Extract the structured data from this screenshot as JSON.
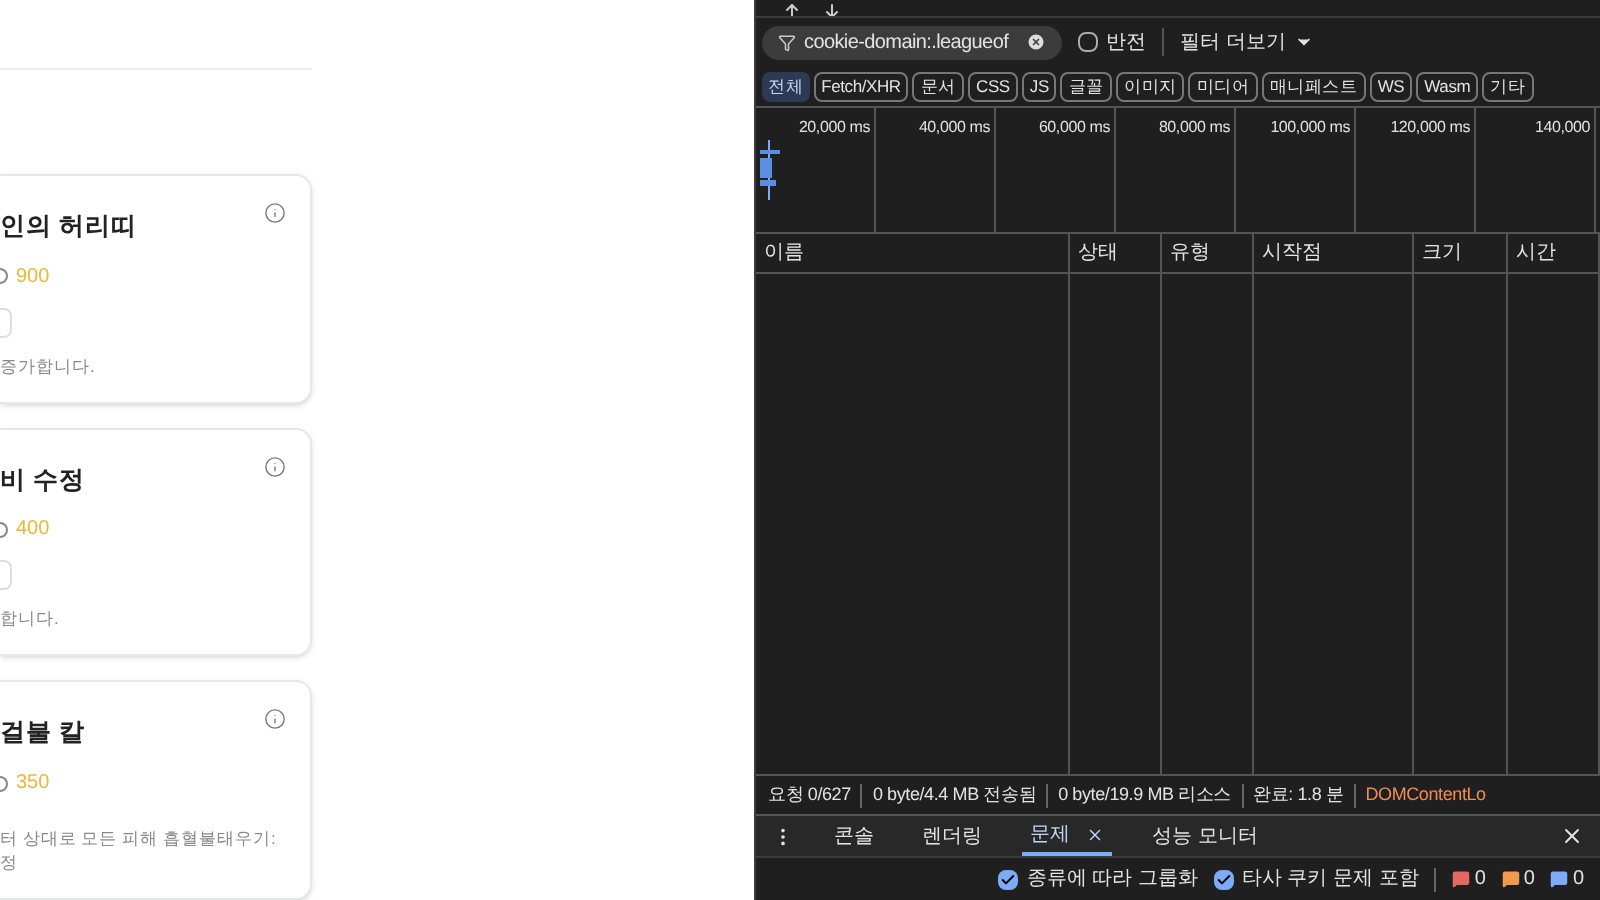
{
  "cards": [
    {
      "title": "인의 허리띠",
      "price": "900",
      "description": "증가합니다.",
      "has_box": true
    },
    {
      "title": "비 수정",
      "price": "400",
      "description": "합니다.",
      "has_box": true
    },
    {
      "title": "걸불 칼",
      "price": "350",
      "description": "터 상대로 모든 피해 흡혈불태우기: 정",
      "has_box": false
    }
  ],
  "devtools": {
    "filter": {
      "value": "cookie-domain:.leagueof",
      "invert": {
        "label": "반전",
        "checked": false
      },
      "more": "필터 더보기"
    },
    "types": [
      {
        "label": "전체",
        "selected": true
      },
      {
        "label": "Fetch/XHR",
        "selected": false
      },
      {
        "label": "문서",
        "selected": false
      },
      {
        "label": "CSS",
        "selected": false
      },
      {
        "label": "JS",
        "selected": false
      },
      {
        "label": "글꼴",
        "selected": false
      },
      {
        "label": "이미지",
        "selected": false
      },
      {
        "label": "미디어",
        "selected": false
      },
      {
        "label": "매니페스트",
        "selected": false
      },
      {
        "label": "WS",
        "selected": false
      },
      {
        "label": "Wasm",
        "selected": false
      },
      {
        "label": "기타",
        "selected": false
      }
    ],
    "timeline": {
      "ticks": [
        "20,000 ms",
        "40,000 ms",
        "60,000 ms",
        "80,000 ms",
        "100,000 ms",
        "120,000 ms",
        "140,000"
      ]
    },
    "table": {
      "columns": [
        "이름",
        "상태",
        "유형",
        "시작점",
        "크기",
        "시간"
      ]
    },
    "status_bar": [
      {
        "text": "요청 0/627",
        "kind": "plain"
      },
      {
        "text": "0 byte/4.4 MB 전송됨",
        "kind": "plain"
      },
      {
        "text": "0 byte/19.9 MB 리소스",
        "kind": "plain"
      },
      {
        "text": "완료: 1.8 분",
        "kind": "plain"
      },
      {
        "text": "DOMContentLo",
        "kind": "event"
      }
    ],
    "drawer_tabs": [
      {
        "label": "콘솔",
        "selected": false,
        "closable": false
      },
      {
        "label": "렌더링",
        "selected": false,
        "closable": false
      },
      {
        "label": "문제",
        "selected": true,
        "closable": true
      },
      {
        "label": "성능 모니터",
        "selected": false,
        "closable": false
      }
    ],
    "issues": {
      "options": [
        {
          "label": "종류에 따라 그룹화",
          "checked": true
        },
        {
          "label": "타사 쿠키 문제 포함",
          "checked": true
        }
      ],
      "counts": [
        {
          "value": "0",
          "color": "#e46962"
        },
        {
          "value": "0",
          "color": "#f29b4c"
        },
        {
          "value": "0",
          "color": "#7cacf8"
        }
      ]
    }
  }
}
